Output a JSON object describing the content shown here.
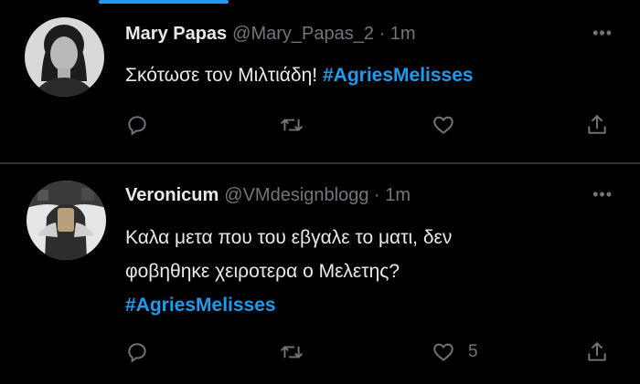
{
  "tweets": [
    {
      "name": "Mary Papas",
      "handle": "@Mary_Papas_2",
      "time": "1m",
      "text": "Σκότωσε τον Μιλτιάδη!",
      "hashtag": "#AgriesMelisses",
      "likes": ""
    },
    {
      "name": "Veronicum",
      "handle": "@VMdesignblogg",
      "time": "1m",
      "text_line1": "Καλα μετα που του εβγαλε το ματι, δεν",
      "text_line2": "φοβηθηκε χειροτερα ο Μελετης?",
      "hashtag": "#AgriesMelisses",
      "likes": "5"
    }
  ],
  "separator": "·",
  "more_glyph": "•••",
  "colors": {
    "accent": "#1d9bf0",
    "muted": "#71767b",
    "text": "#e7e9ea",
    "bg": "#000000"
  },
  "icons": [
    "reply-icon",
    "retweet-icon",
    "like-icon",
    "share-icon",
    "more-icon"
  ]
}
